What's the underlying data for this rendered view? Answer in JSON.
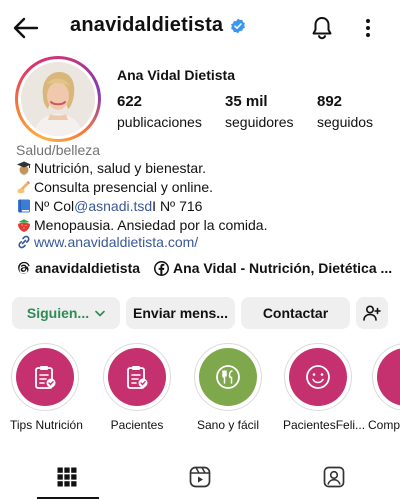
{
  "header": {
    "username": "anavidaldietista",
    "back_icon": "arrow-left-icon",
    "verified_icon": "verified-badge-icon",
    "bell_icon": "bell-icon",
    "more_icon": "more-vertical-icon"
  },
  "profile": {
    "full_name": "Ana Vidal Dietista",
    "stats": [
      {
        "value": "622",
        "label": "publicaciones"
      },
      {
        "value": "35 mil",
        "label": "seguidores"
      },
      {
        "value": "892",
        "label": "seguidos"
      }
    ],
    "category": "Salud/belleza",
    "bio": {
      "line1": "Nutrición, salud y bienestar.",
      "line2": " Consulta presencial y online.",
      "line3_prefix": "Nº Col ",
      "line3_mention": "@asnadi.tsd",
      "line3_suffix": " I Nº 716",
      "line4": "Menopausia. Ansiedad por la comida.",
      "link": "www.anavidaldietista.com/"
    },
    "threads_handle": "anavidaldietista",
    "facebook_name": "Ana Vidal - Nutrición, Dietética ..."
  },
  "buttons": {
    "following": "Siguien...",
    "message": "Enviar mens...",
    "contact": "Contactar",
    "add_user_icon": "add-person-icon"
  },
  "highlights": [
    {
      "label": "Tips Nutrición",
      "color": "#c5306f",
      "icon": "clipboard-check-icon"
    },
    {
      "label": "Pacientes",
      "color": "#c5306f",
      "icon": "clipboard-check-icon"
    },
    {
      "label": "Sano y fácil",
      "color": "#7fa84d",
      "icon": "fork-knife-icon"
    },
    {
      "label": "PacientesFeli...",
      "color": "#c5306f",
      "icon": "smiley-icon"
    },
    {
      "label": "Compr",
      "color": "#c5306f",
      "icon": "clipboard-check-icon"
    }
  ],
  "tabs": [
    {
      "name": "grid",
      "icon": "grid-icon",
      "active": true
    },
    {
      "name": "reels",
      "icon": "reels-icon",
      "active": false
    },
    {
      "name": "tagged",
      "icon": "tagged-icon",
      "active": false
    }
  ],
  "colors": {
    "accent_link": "#385898",
    "following_text": "#2e8b57",
    "button_bg": "#efefef",
    "category_gray": "#737373"
  }
}
